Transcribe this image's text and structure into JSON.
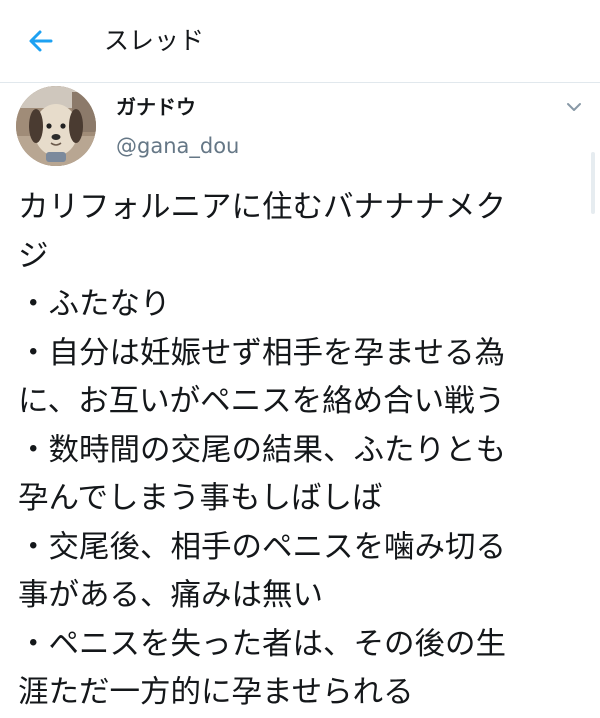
{
  "header": {
    "title": "スレッド",
    "back_icon": "arrow-left-icon"
  },
  "author": {
    "name": "ガナドウ",
    "handle": "@gana_dou",
    "avatar_icon": "dog-mask-avatar",
    "menu_icon": "chevron-down-icon"
  },
  "tweet": {
    "lines": [
      "カリフォルニアに住むバナナナメク",
      "ジ",
      "・ふたなり",
      "・自分は妊娠せず相手を孕ませる為",
      "に、お互いがペニスを絡め合い戦う",
      "・数時間の交尾の結果、ふたりとも",
      "孕んでしまう事もしばしば",
      "・交尾後、相手のペニスを噛み切る",
      "事がある、痛みは無い",
      "・ペニスを失った者は、その後の生",
      "涯ただ一方的に孕ませられる"
    ]
  },
  "colors": {
    "accent": "#1da1f2",
    "text": "#14171a",
    "secondary_text": "#657786",
    "divider": "#e1e8ed"
  }
}
